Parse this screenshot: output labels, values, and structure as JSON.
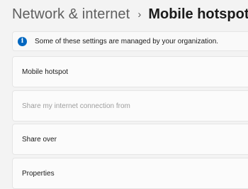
{
  "breadcrumb": {
    "parent": "Network & internet",
    "separator": "›",
    "current": "Mobile hotspot"
  },
  "banner": {
    "icon": "info-icon",
    "icon_glyph": "i",
    "text": "Some of these settings are managed by your organization."
  },
  "settings": [
    {
      "label": "Mobile hotspot",
      "enabled": true
    },
    {
      "label": "Share my internet connection from",
      "enabled": false
    },
    {
      "label": "Share over",
      "enabled": true
    },
    {
      "label": "Properties",
      "enabled": true
    }
  ],
  "colors": {
    "accent": "#0067c0",
    "background": "#f3f3f3",
    "card": "#fbfbfb",
    "disabled_text": "#9e9e9e"
  }
}
